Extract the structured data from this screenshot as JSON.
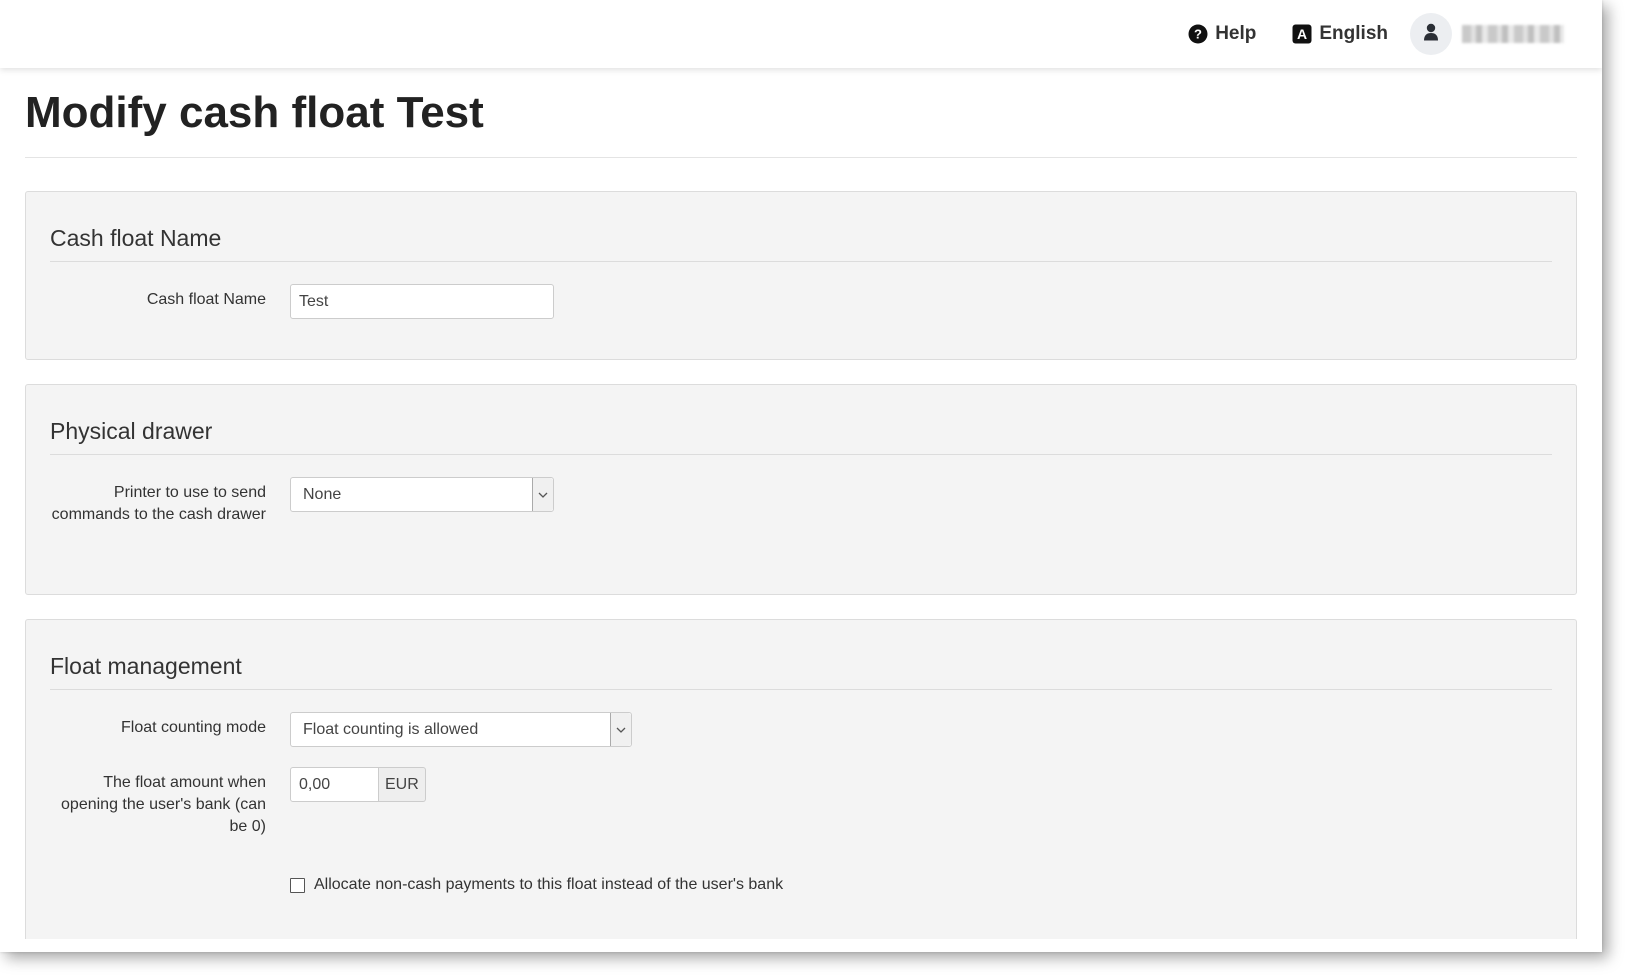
{
  "header": {
    "help_label": "Help",
    "language_label": "English",
    "help_icon": "question-circle-icon",
    "language_icon": "translate-icon",
    "user_icon": "user-icon"
  },
  "page": {
    "title": "Modify cash float Test"
  },
  "sections": {
    "name": {
      "title": "Cash float Name",
      "field_label": "Cash float Name",
      "field_value": "Test"
    },
    "drawer": {
      "title": "Physical drawer",
      "printer_label": "Printer to use to send commands to the cash drawer",
      "printer_value": "None"
    },
    "float": {
      "title": "Float management",
      "mode_label": "Float counting mode",
      "mode_value": "Float counting is allowed",
      "amount_label": "The float amount when opening the user's bank (can be 0)",
      "amount_value": "0,00",
      "currency": "EUR",
      "allocate_label": "Allocate non-cash payments to this float instead of the user's bank",
      "allocate_checked": false
    }
  }
}
